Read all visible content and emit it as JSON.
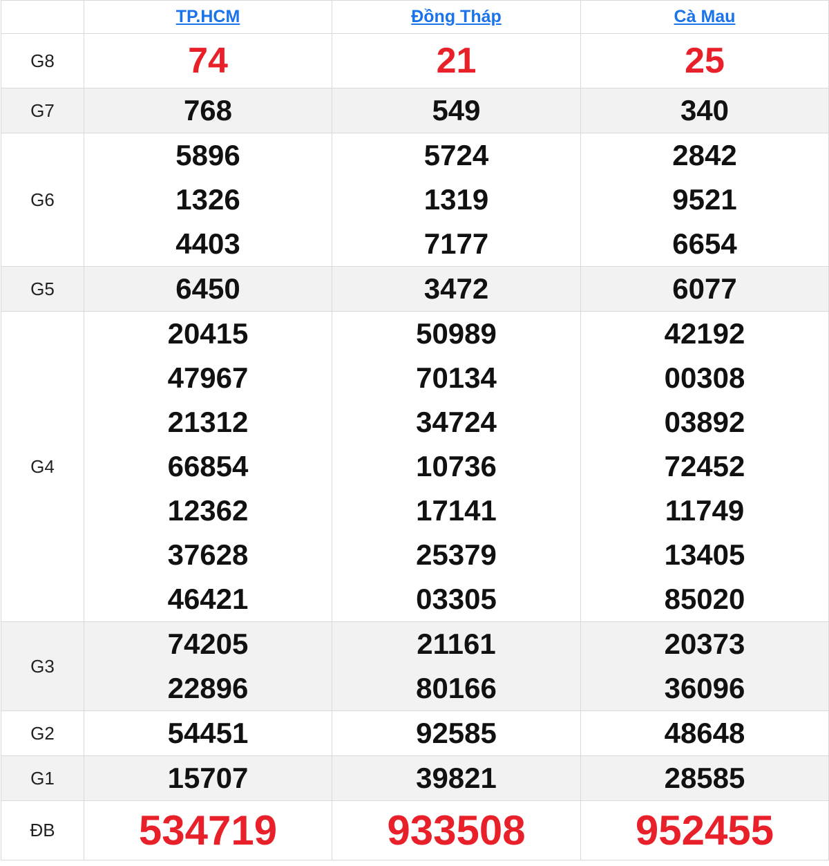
{
  "provinces": [
    {
      "name": "TP.HCM"
    },
    {
      "name": "Đồng Tháp"
    },
    {
      "name": "Cà Mau"
    }
  ],
  "prizes": [
    {
      "label": "G8",
      "results": [
        [
          "74"
        ],
        [
          "21"
        ],
        [
          "25"
        ]
      ]
    },
    {
      "label": "G7",
      "results": [
        [
          "768"
        ],
        [
          "549"
        ],
        [
          "340"
        ]
      ]
    },
    {
      "label": "G6",
      "results": [
        [
          "5896",
          "1326",
          "4403"
        ],
        [
          "5724",
          "1319",
          "7177"
        ],
        [
          "2842",
          "9521",
          "6654"
        ]
      ]
    },
    {
      "label": "G5",
      "results": [
        [
          "6450"
        ],
        [
          "3472"
        ],
        [
          "6077"
        ]
      ]
    },
    {
      "label": "G4",
      "results": [
        [
          "20415",
          "47967",
          "21312",
          "66854",
          "12362",
          "37628",
          "46421"
        ],
        [
          "50989",
          "70134",
          "34724",
          "10736",
          "17141",
          "25379",
          "03305"
        ],
        [
          "42192",
          "00308",
          "03892",
          "72452",
          "11749",
          "13405",
          "85020"
        ]
      ]
    },
    {
      "label": "G3",
      "results": [
        [
          "74205",
          "22896"
        ],
        [
          "21161",
          "80166"
        ],
        [
          "20373",
          "36096"
        ]
      ]
    },
    {
      "label": "G2",
      "results": [
        [
          "54451"
        ],
        [
          "92585"
        ],
        [
          "48648"
        ]
      ]
    },
    {
      "label": "G1",
      "results": [
        [
          "15707"
        ],
        [
          "39821"
        ],
        [
          "28585"
        ]
      ]
    },
    {
      "label": "ĐB",
      "results": [
        [
          "534719"
        ],
        [
          "933508"
        ],
        [
          "952455"
        ]
      ]
    }
  ],
  "colors": {
    "link": "#1a73e8",
    "highlight": "#e8202a",
    "number": "#111111",
    "alt_row_bg": "#f2f2f2",
    "border": "#d9d9d9"
  }
}
